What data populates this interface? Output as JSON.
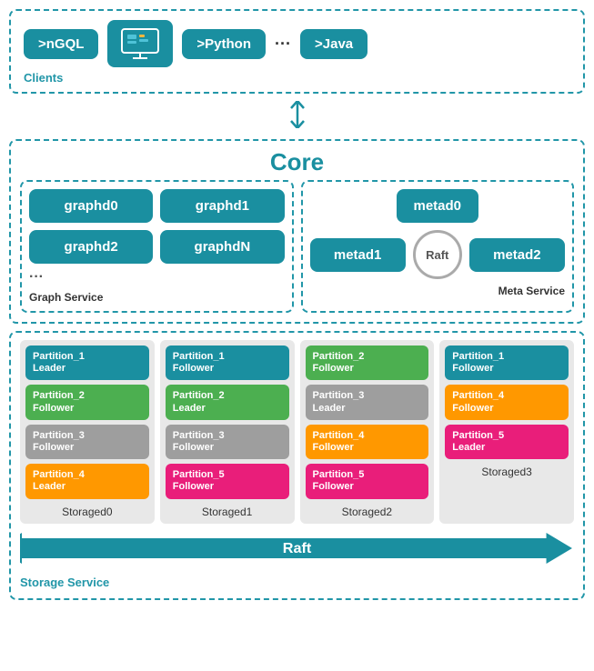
{
  "clients": {
    "label": "Clients",
    "items": [
      {
        "id": "ngql",
        "text": ">nGQL",
        "type": "text-box"
      },
      {
        "id": "monitor",
        "text": "🖥",
        "type": "icon-box"
      },
      {
        "id": "python",
        "text": ">Python",
        "type": "text-box"
      },
      {
        "id": "dots",
        "text": "···",
        "type": "dots"
      },
      {
        "id": "java",
        "text": ">Java",
        "type": "text-box"
      }
    ]
  },
  "core": {
    "title": "Core",
    "graph_service": {
      "label": "Graph Service",
      "nodes": [
        "graphd0",
        "graphd1",
        "graphd2",
        "graphdN"
      ]
    },
    "meta_service": {
      "label": "Meta Service",
      "nodes": [
        "metad0",
        "metad1",
        "Raft",
        "metad2"
      ]
    }
  },
  "storage": {
    "label": "Storage Service",
    "raft_label": "Raft",
    "columns": [
      {
        "id": "storaged0",
        "label": "Storaged0",
        "partitions": [
          {
            "name": "Partition_1\nLeader",
            "color": "teal"
          },
          {
            "name": "Partition_2\nFollower",
            "color": "green"
          },
          {
            "name": "Partition_3\nFollower",
            "color": "gray"
          },
          {
            "name": "Partition_4\nLeader",
            "color": "orange"
          }
        ]
      },
      {
        "id": "storaged1",
        "label": "Storaged1",
        "partitions": [
          {
            "name": "Partition_1\nFollower",
            "color": "teal"
          },
          {
            "name": "Partition_2\nLeader",
            "color": "green"
          },
          {
            "name": "Partition_3\nFollower",
            "color": "gray"
          },
          {
            "name": "Partition_5\nFollower",
            "color": "pink"
          }
        ]
      },
      {
        "id": "storaged2",
        "label": "Storaged2",
        "partitions": [
          {
            "name": "Partition_2\nFollower",
            "color": "green"
          },
          {
            "name": "Partition_3\nLeader",
            "color": "gray"
          },
          {
            "name": "Partition_4\nFollower",
            "color": "orange"
          },
          {
            "name": "Partition_5\nFollower",
            "color": "pink"
          }
        ]
      },
      {
        "id": "storaged3",
        "label": "Storaged3",
        "partitions": [
          {
            "name": "Partition_1\nFollower",
            "color": "teal"
          },
          {
            "name": "Partition_4\nFollower",
            "color": "orange"
          },
          {
            "name": "Partition_5\nLeader",
            "color": "pink"
          }
        ]
      }
    ]
  }
}
